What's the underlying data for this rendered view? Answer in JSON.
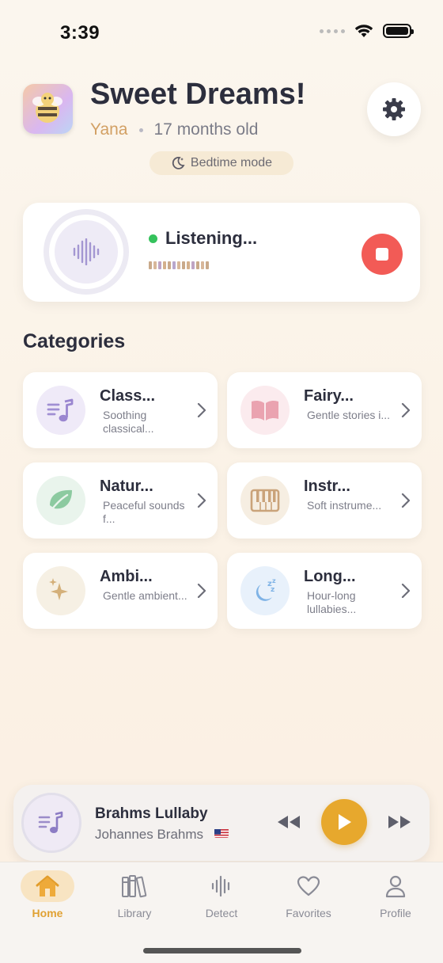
{
  "status_bar": {
    "time": "3:39"
  },
  "header": {
    "title": "Sweet Dreams!",
    "child_name": "Yana",
    "child_age": "17 months old",
    "mode_label": "Bedtime mode"
  },
  "listening": {
    "status_label": "Listening...",
    "status_color": "#35c25c"
  },
  "categories": {
    "title": "Categories",
    "items": [
      {
        "title": "Class...",
        "desc": "Soothing classical...",
        "icon": "music-note-icon",
        "icon_bg": "#efeaf8"
      },
      {
        "title": "Fairy...",
        "desc": "Gentle stories i...",
        "icon": "book-icon",
        "icon_bg": "#fbebee"
      },
      {
        "title": "Natur...",
        "desc": "Peaceful sounds f...",
        "icon": "leaf-icon",
        "icon_bg": "#e9f4ec"
      },
      {
        "title": "Instr...",
        "desc": "Soft instrume...",
        "icon": "piano-icon",
        "icon_bg": "#f6eee2"
      },
      {
        "title": "Ambi...",
        "desc": "Gentle ambient...",
        "icon": "sparkles-icon",
        "icon_bg": "#f6f0e4"
      },
      {
        "title": "Long...",
        "desc": "Hour-long lullabies...",
        "icon": "moon-zzz-icon",
        "icon_bg": "#e8f1fb"
      }
    ]
  },
  "now_playing": {
    "title": "Brahms Lullaby",
    "artist": "Johannes Brahms",
    "accent_color": "#e7a82d"
  },
  "tabs": [
    {
      "label": "Home",
      "icon": "home-icon",
      "active": true
    },
    {
      "label": "Library",
      "icon": "library-icon",
      "active": false
    },
    {
      "label": "Detect",
      "icon": "waveform-icon",
      "active": false
    },
    {
      "label": "Favorites",
      "icon": "heart-icon",
      "active": false
    },
    {
      "label": "Profile",
      "icon": "person-icon",
      "active": false
    }
  ]
}
